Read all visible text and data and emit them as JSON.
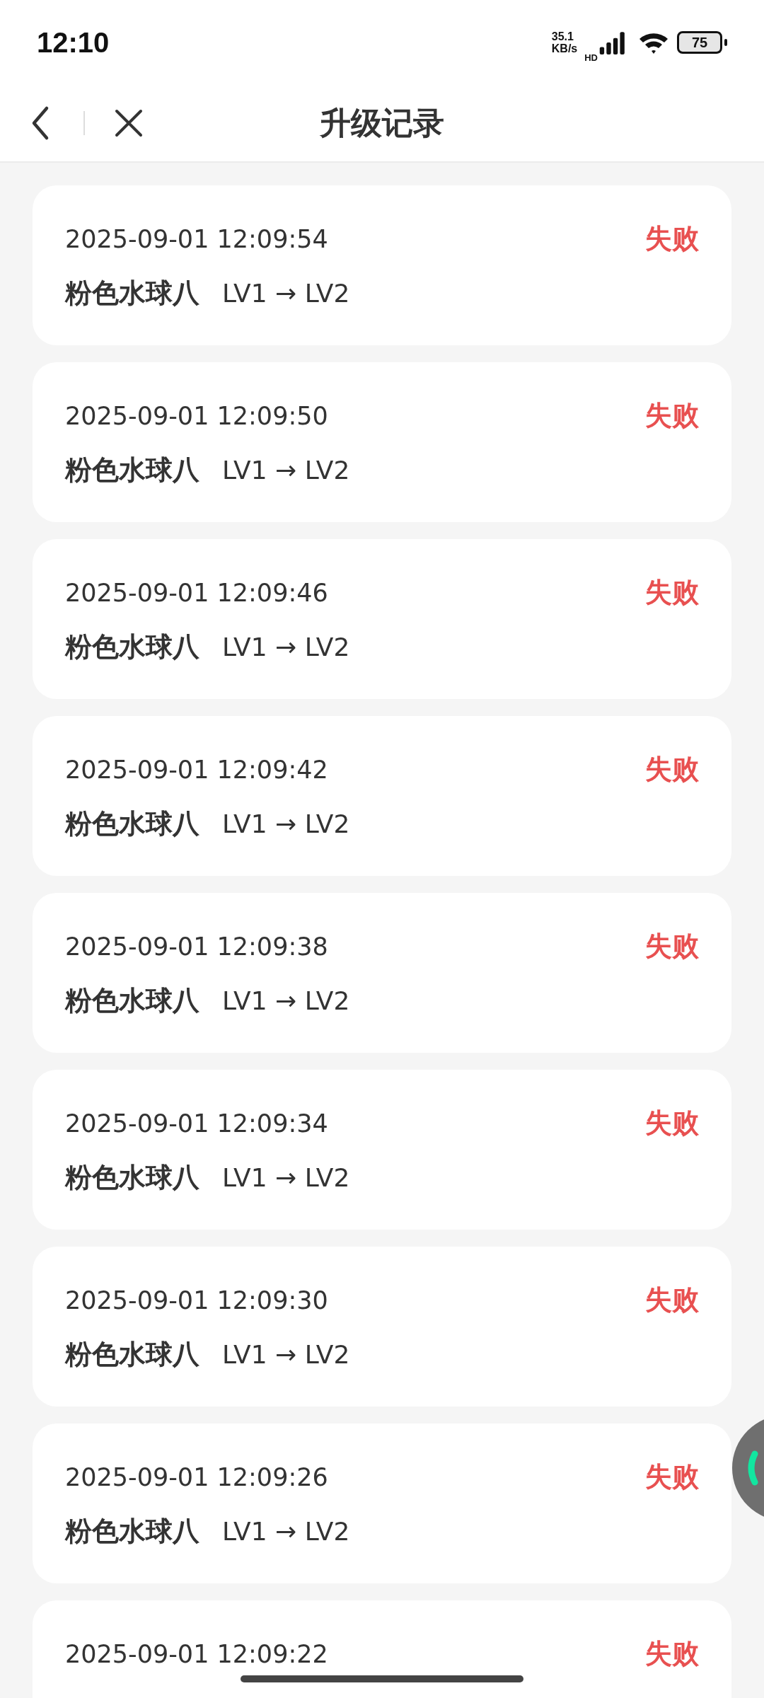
{
  "status_bar": {
    "time": "12:10",
    "net_speed": "35.1 KB/s",
    "network": "HD",
    "battery": "75"
  },
  "header": {
    "title": "升级记录"
  },
  "records": [
    {
      "time": "2025-09-01 12:09:54",
      "result": "失败",
      "kind": "failed",
      "name": "粉色水球八",
      "levels": "LV1 → LV2"
    },
    {
      "time": "2025-09-01 12:09:50",
      "result": "失败",
      "kind": "failed",
      "name": "粉色水球八",
      "levels": "LV1 → LV2"
    },
    {
      "time": "2025-09-01 12:09:46",
      "result": "失败",
      "kind": "failed",
      "name": "粉色水球八",
      "levels": "LV1 → LV2"
    },
    {
      "time": "2025-09-01 12:09:42",
      "result": "失败",
      "kind": "failed",
      "name": "粉色水球八",
      "levels": "LV1 → LV2"
    },
    {
      "time": "2025-09-01 12:09:38",
      "result": "失败",
      "kind": "failed",
      "name": "粉色水球八",
      "levels": "LV1 → LV2"
    },
    {
      "time": "2025-09-01 12:09:34",
      "result": "失败",
      "kind": "failed",
      "name": "粉色水球八",
      "levels": "LV1 → LV2"
    },
    {
      "time": "2025-09-01 12:09:30",
      "result": "失败",
      "kind": "failed",
      "name": "粉色水球八",
      "levels": "LV1 → LV2"
    },
    {
      "time": "2025-09-01 12:09:26",
      "result": "失败",
      "kind": "failed",
      "name": "粉色水球八",
      "levels": "LV1 → LV2"
    },
    {
      "time": "2025-09-01 12:09:22",
      "result": "失败",
      "kind": "failed"
    }
  ]
}
